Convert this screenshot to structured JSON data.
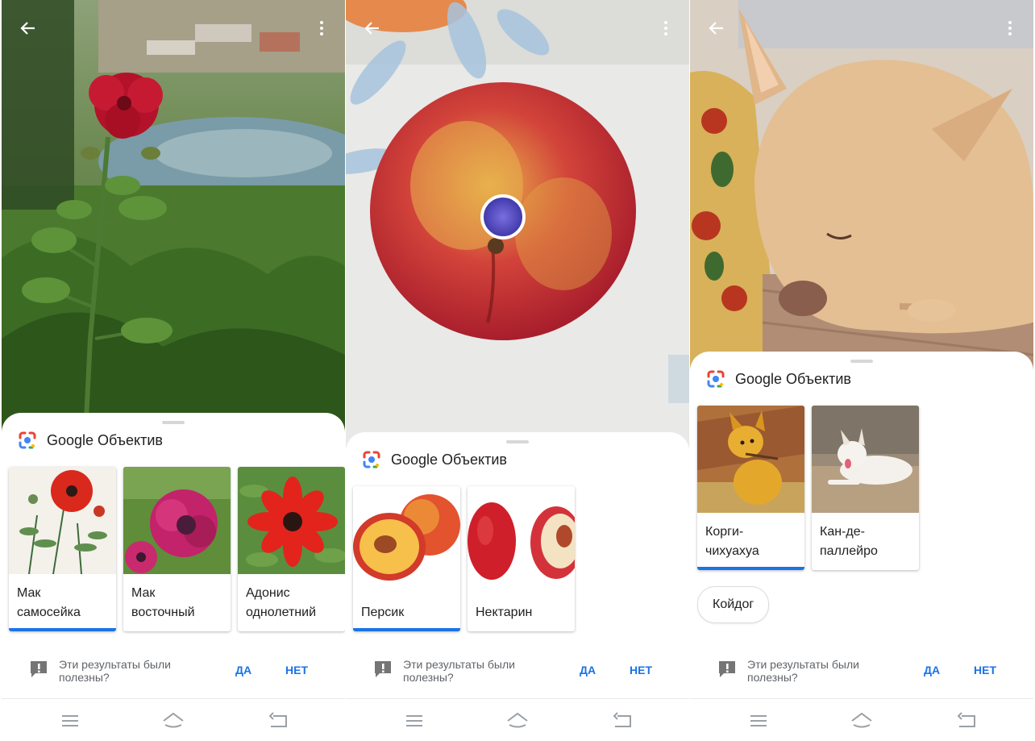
{
  "colors": {
    "accent": "#1a73e8",
    "sheet": "#ffffff",
    "divider": "#dadce0"
  },
  "icons": {
    "back": "arrow-left-icon",
    "more": "more-vertical-icon",
    "lens": "google-lens-icon",
    "feedback": "feedback-exclamation-icon",
    "nav_menu": "menu-lines-icon",
    "nav_home": "home-icon",
    "nav_back": "back-nav-icon"
  },
  "panels": [
    {
      "lens_title": "Google Объектив",
      "results": [
        {
          "label": "Мак\nсамосейка",
          "selected": true
        },
        {
          "label": "Мак\nвосточный",
          "selected": false
        },
        {
          "label": "Адонис\nоднолетний",
          "selected": false
        }
      ],
      "feedback": {
        "question": "Эти результаты были полезны?",
        "yes": "ДА",
        "no": "НЕТ"
      }
    },
    {
      "lens_title": "Google Объектив",
      "results": [
        {
          "label": "Персик",
          "selected": true
        },
        {
          "label": "Нектарин",
          "selected": false
        }
      ],
      "feedback": {
        "question": "Эти результаты были полезны?",
        "yes": "ДА",
        "no": "НЕТ"
      }
    },
    {
      "lens_title": "Google Объектив",
      "results": [
        {
          "label": "Корги-\nчихуахуа",
          "selected": true
        },
        {
          "label": "Кан-де-\nпаллейро",
          "selected": false
        }
      ],
      "chip": "Койдог",
      "feedback": {
        "question": "Эти результаты были полезны?",
        "yes": "ДА",
        "no": "НЕТ"
      }
    }
  ]
}
